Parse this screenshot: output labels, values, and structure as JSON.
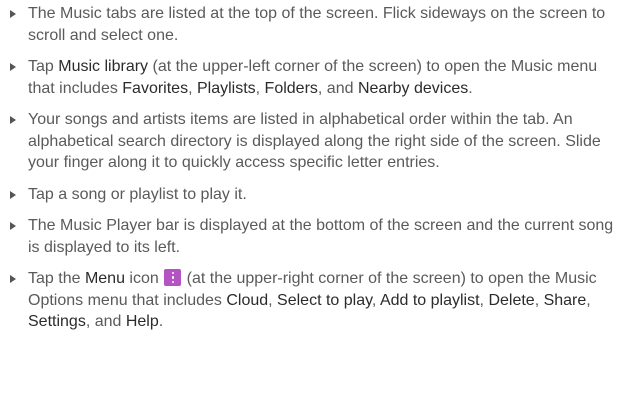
{
  "colors": {
    "text": "#5a5a5a",
    "highlight": "#2b2b2b",
    "menu_icon_bg": "#b453c4"
  },
  "bullets": [
    {
      "t1": "The Music tabs are listed at the top of the screen. Flick sideways on the screen to scroll and select one."
    },
    {
      "t1": "Tap ",
      "h1": "Music library",
      "t2": " (at the upper-left corner of the screen) to open the Music menu that includes ",
      "h2": "Favorites",
      "t3": ", ",
      "h3": "Playlists",
      "t4": ", ",
      "h4": "Folders",
      "t5": ", and ",
      "h5": "Nearby devices",
      "t6": "."
    },
    {
      "t1": "Your songs and artists items are listed in alphabetical order within the tab. An alphabetical search directory is displayed along the right side of the screen. Slide your finger along it to quickly access specific letter entries."
    },
    {
      "t1": "Tap a song or playlist to play it."
    },
    {
      "t1": "The Music Player bar is displayed at the bottom of the screen and the current song is displayed to its left."
    },
    {
      "t1": "Tap the ",
      "h1": "Menu",
      "t2": " icon ",
      "icon": "vertical-dots-menu-icon",
      "t3": " (at the upper-right corner of the screen) to open the Music Options menu that includes ",
      "h2": "Cloud",
      "t4": ", ",
      "h3": "Select to play",
      "t5": ", ",
      "h4": "Add to playlist",
      "t6": ", ",
      "h5": "Delete",
      "t7": ", ",
      "h6": "Share",
      "t8": ", ",
      "h7": "Settings",
      "t9": ", and ",
      "h8": "Help",
      "t10": "."
    }
  ]
}
